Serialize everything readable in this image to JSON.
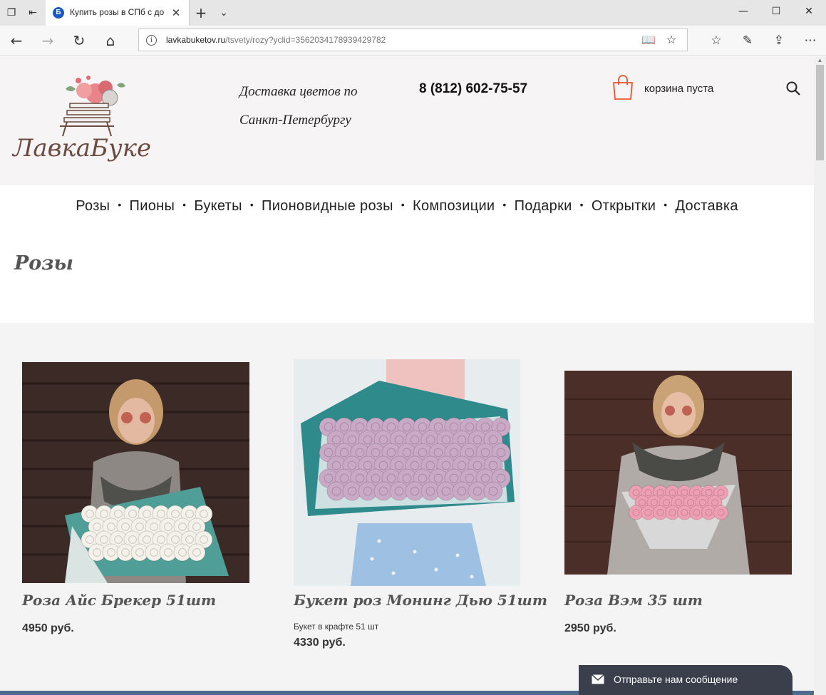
{
  "browser": {
    "tab_title": "Купить розы в СПб с до",
    "tab_favicon": "Б",
    "url_domain": "lavkabuketov.ru",
    "url_path": "/tsvety/rozy?yclid=3562034178939429782"
  },
  "header": {
    "logo_text": "ЛавкаБукетов",
    "delivery_text": "Доставка цветов по Санкт-Петербургу",
    "phone": "8 (812) 602-75-57",
    "cart_text": "корзина пуста"
  },
  "menu": {
    "items": [
      "Розы",
      "Пионы",
      "Букеты",
      "Пионовидные розы",
      "Композиции",
      "Подарки",
      "Открытки",
      "Доставка"
    ],
    "separator": "•"
  },
  "page_title": "Розы",
  "products": [
    {
      "name": "Роза Айс Брекер 51шт",
      "description": "",
      "price": "4950 руб.",
      "flower_color": "#f4f1ea"
    },
    {
      "name": "Букет роз Монинг Дью 51шт",
      "description": "Букет в крафте 51 шт",
      "price": "4330 руб.",
      "flower_color": "#c9a9c6"
    },
    {
      "name": "Роза Вэм 35 шт",
      "description": "",
      "price": "2950 руб.",
      "flower_color": "#ef9fb4"
    }
  ],
  "chat": {
    "label": "Отправьте нам сообщение"
  },
  "colors": {
    "accent_cart": "#e8542b",
    "title_gray": "#555555",
    "chat_bg": "#3a3f4b"
  }
}
